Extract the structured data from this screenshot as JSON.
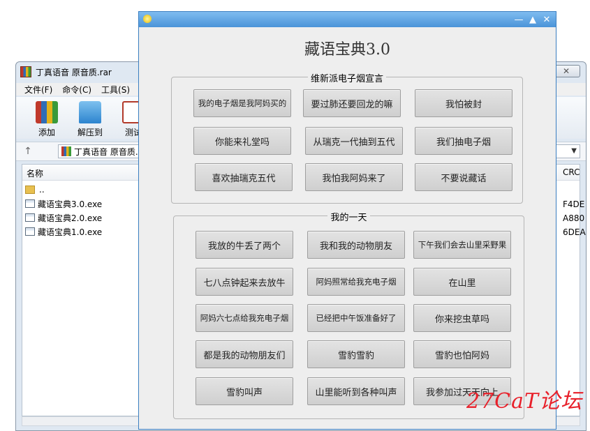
{
  "background_window": {
    "title": "丁真语音 原音质.rar",
    "close_icon": "close-x",
    "menu": [
      "文件(F)",
      "命令(C)",
      "工具(S)"
    ],
    "toolbar": [
      {
        "label": "添加",
        "icon": "winrar-books-icon"
      },
      {
        "label": "解压到",
        "icon": "folder-extract-icon"
      },
      {
        "label": "测试",
        "icon": "clipboard-check-icon"
      }
    ],
    "address": "丁真语音 原音质.",
    "columns": {
      "name": "名称",
      "crc": "CRC"
    },
    "files": [
      {
        "name": "..",
        "type": "folder",
        "crc": ""
      },
      {
        "name": "藏语宝典3.0.exe",
        "type": "file",
        "crc": "F4DE"
      },
      {
        "name": "藏语宝典2.0.exe",
        "type": "file",
        "crc": "A880"
      },
      {
        "name": "藏语宝典1.0.exe",
        "type": "file",
        "crc": "6DEA"
      }
    ]
  },
  "app": {
    "title": "藏语宝典3.0",
    "window_controls": {
      "minimize": "—",
      "maximize": "▲",
      "close": "✕"
    },
    "group1": {
      "legend": "维新派电子烟宣言",
      "buttons": [
        "我的电子烟是我阿妈买的",
        "要过肺还要回龙的嘛",
        "我怕被封",
        "你能来礼堂吗",
        "从瑞克一代抽到五代",
        "我们抽电子烟",
        "喜欢抽瑞克五代",
        "我怕我阿妈来了",
        "不要说藏话"
      ]
    },
    "group2": {
      "legend": "我的一天",
      "buttons": [
        "我放的牛丢了两个",
        "我和我的动物朋友",
        "下午我们会去山里采野果",
        "七八点钟起来去放牛",
        "阿妈照常给我充电子烟",
        "在山里",
        "阿妈六七点给我充电子烟",
        "已经把中午饭准备好了",
        "你来挖虫草吗",
        "都是我的动物朋友们",
        "雪豹雪豹",
        "雪豹也怕阿妈",
        "雪豹叫声",
        "山里能听到各种叫声",
        "我参加过天天向上"
      ]
    }
  },
  "watermark": "27CaT论坛"
}
